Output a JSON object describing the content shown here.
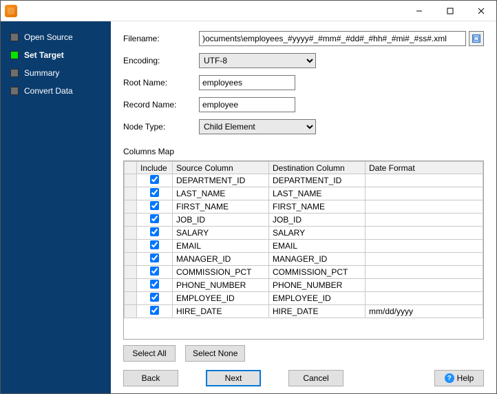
{
  "sidebar": {
    "items": [
      {
        "label": "Open Source",
        "active": false
      },
      {
        "label": "Set Target",
        "active": true
      },
      {
        "label": "Summary",
        "active": false
      },
      {
        "label": "Convert Data",
        "active": false
      }
    ]
  },
  "form": {
    "filename": {
      "label": "Filename:",
      "value": ")ocuments\\employees_#yyyy#_#mm#_#dd#_#hh#_#mi#_#ss#.xml"
    },
    "encoding": {
      "label": "Encoding:",
      "value": "UTF-8"
    },
    "root_name": {
      "label": "Root Name:",
      "value": "employees"
    },
    "record_name": {
      "label": "Record Name:",
      "value": "employee"
    },
    "node_type": {
      "label": "Node Type:",
      "value": "Child Element"
    }
  },
  "columns_map": {
    "label": "Columns Map",
    "headers": [
      "Include",
      "Source Column",
      "Destination Column",
      "Date Format"
    ],
    "rows": [
      {
        "include": true,
        "source": "DEPARTMENT_ID",
        "destination": "DEPARTMENT_ID",
        "date_format": ""
      },
      {
        "include": true,
        "source": "LAST_NAME",
        "destination": "LAST_NAME",
        "date_format": ""
      },
      {
        "include": true,
        "source": "FIRST_NAME",
        "destination": "FIRST_NAME",
        "date_format": ""
      },
      {
        "include": true,
        "source": "JOB_ID",
        "destination": "JOB_ID",
        "date_format": ""
      },
      {
        "include": true,
        "source": "SALARY",
        "destination": "SALARY",
        "date_format": ""
      },
      {
        "include": true,
        "source": "EMAIL",
        "destination": "EMAIL",
        "date_format": ""
      },
      {
        "include": true,
        "source": "MANAGER_ID",
        "destination": "MANAGER_ID",
        "date_format": ""
      },
      {
        "include": true,
        "source": "COMMISSION_PCT",
        "destination": "COMMISSION_PCT",
        "date_format": ""
      },
      {
        "include": true,
        "source": "PHONE_NUMBER",
        "destination": "PHONE_NUMBER",
        "date_format": ""
      },
      {
        "include": true,
        "source": "EMPLOYEE_ID",
        "destination": "EMPLOYEE_ID",
        "date_format": ""
      },
      {
        "include": true,
        "source": "HIRE_DATE",
        "destination": "HIRE_DATE",
        "date_format": "mm/dd/yyyy"
      }
    ]
  },
  "buttons": {
    "select_all": "Select All",
    "select_none": "Select None",
    "back": "Back",
    "next": "Next",
    "cancel": "Cancel",
    "help": "Help"
  }
}
